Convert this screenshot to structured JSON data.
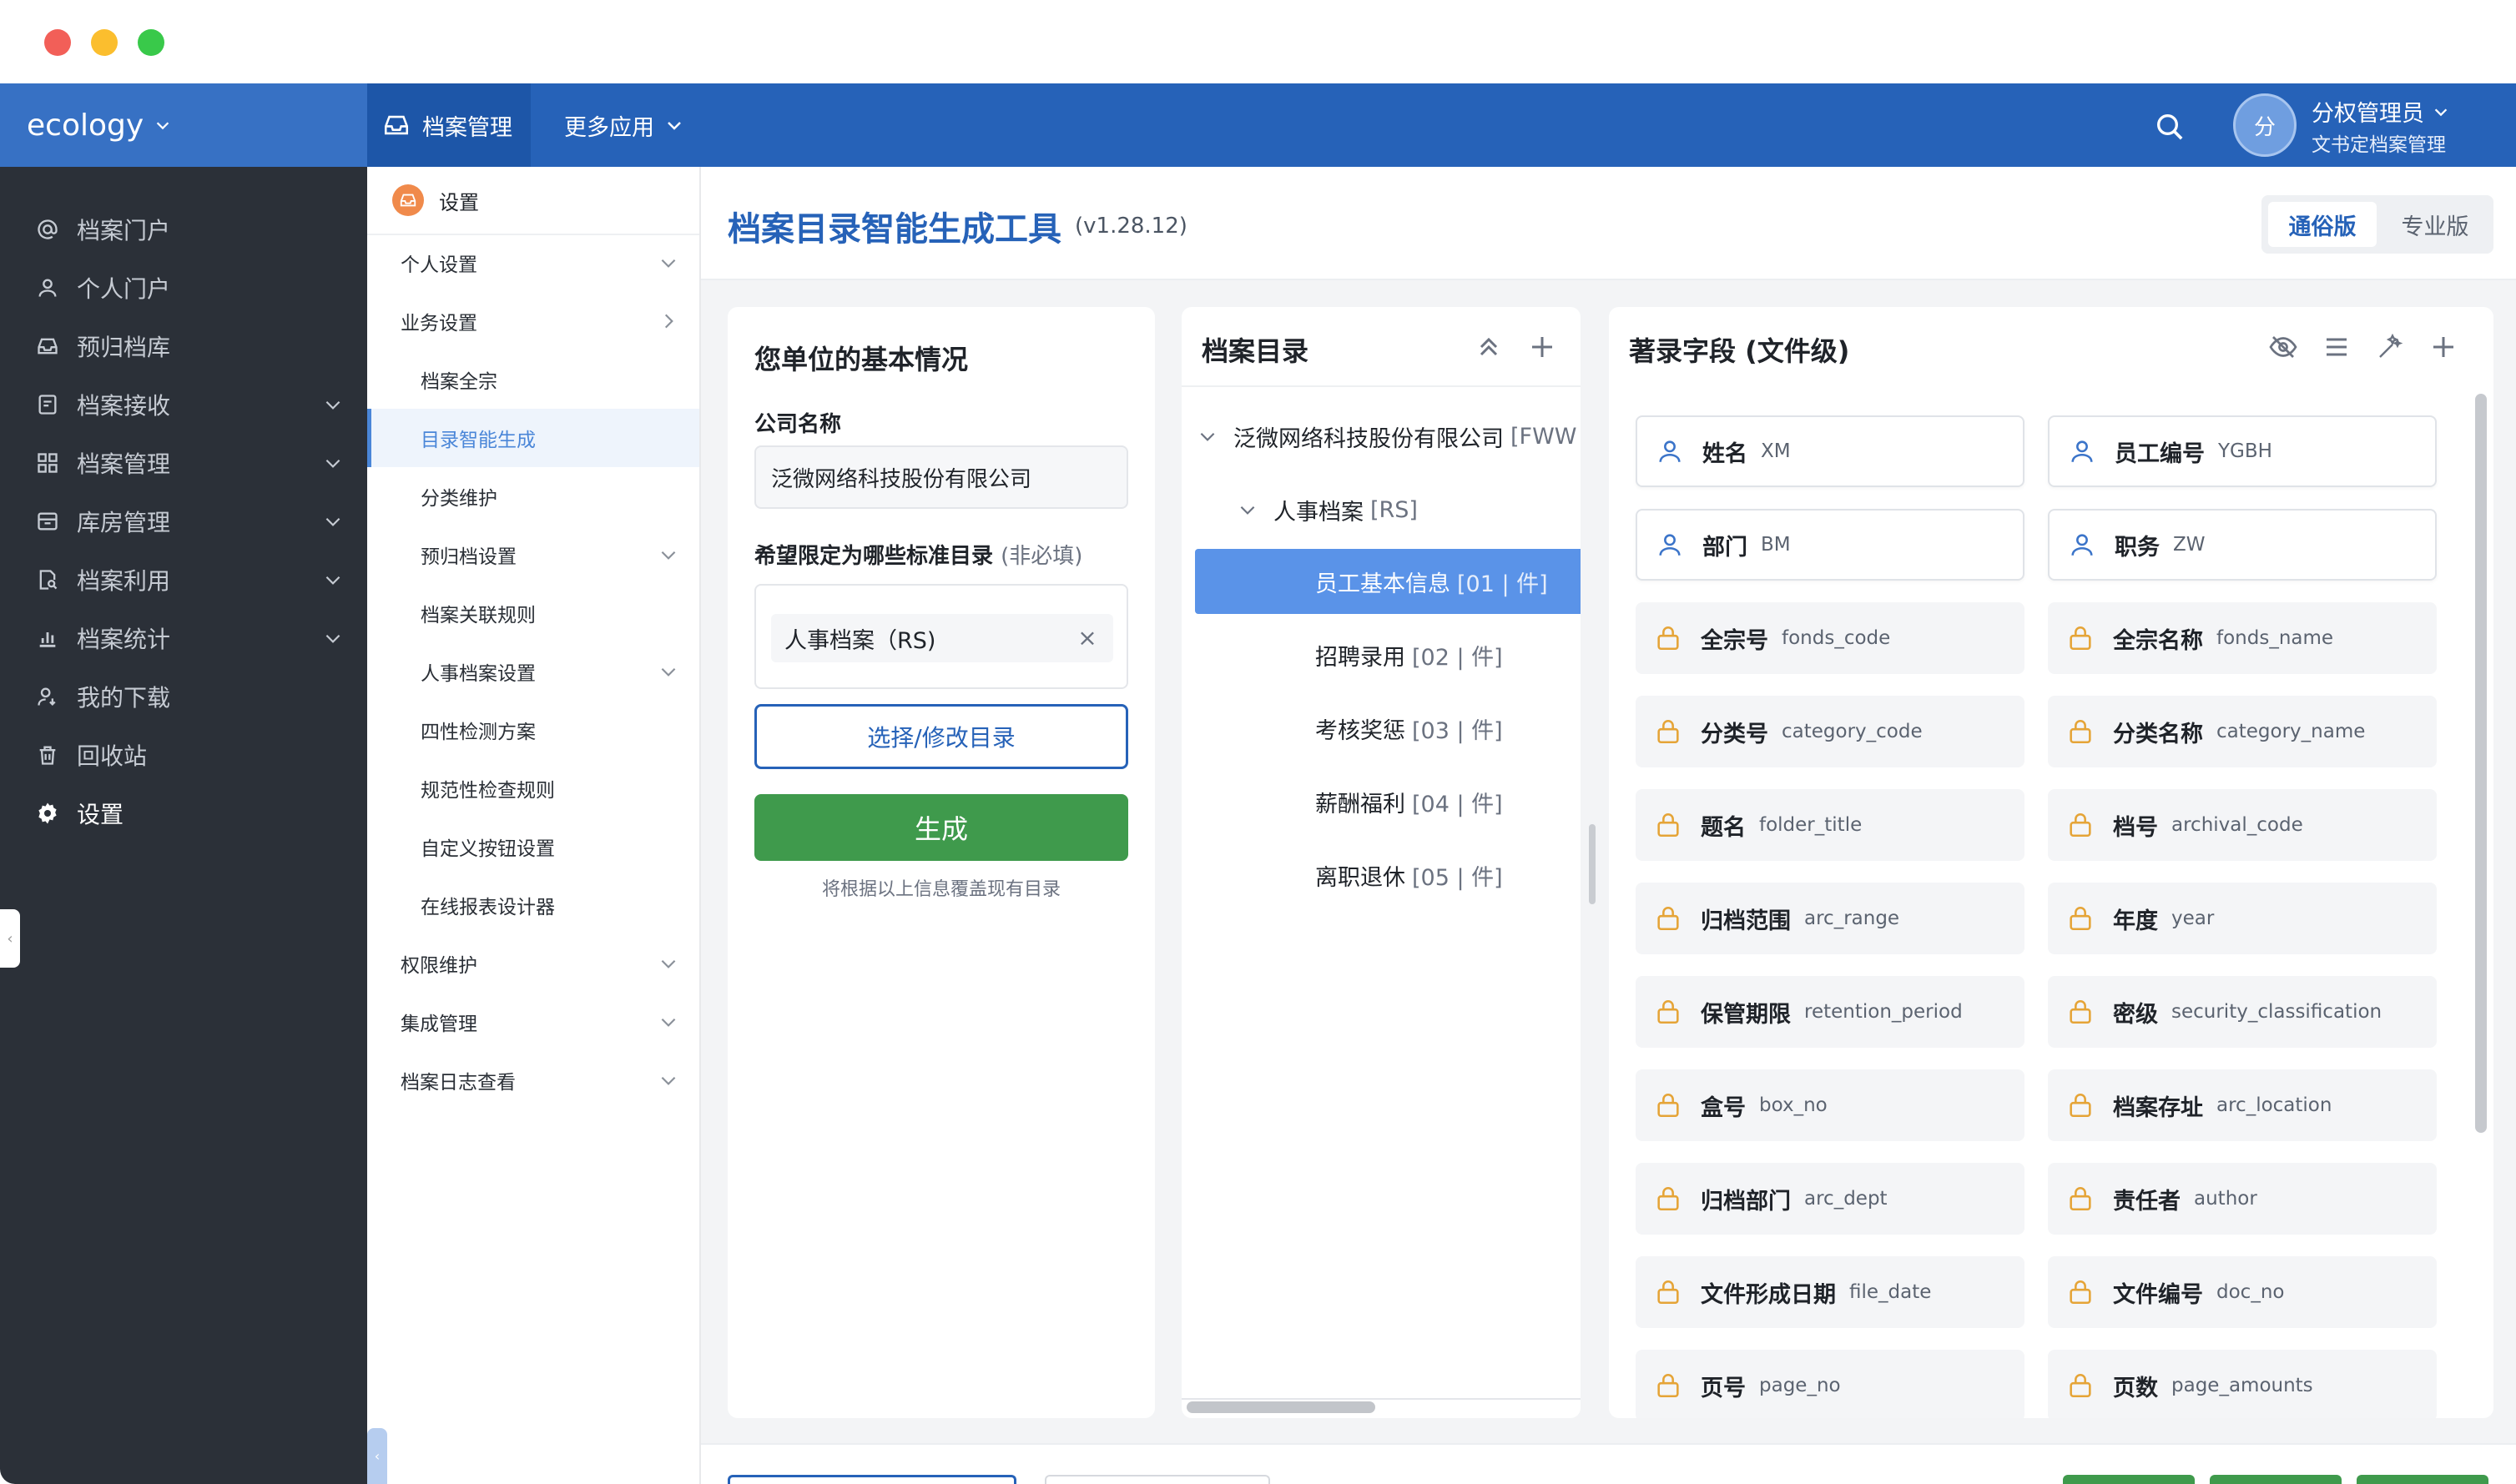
{
  "window": {
    "traffic_lights": [
      "#f25f58",
      "#fbbe2e",
      "#39c94a"
    ]
  },
  "topnav": {
    "brand": "ecology",
    "tabs": [
      {
        "label": "档案管理"
      },
      {
        "label": "更多应用"
      }
    ],
    "user": {
      "avatar_text": "分",
      "name": "分权管理员",
      "role": "文书定档案管理"
    },
    "colors": {
      "bar": "#2662b8",
      "brand": "#3771c4"
    }
  },
  "sidebar": {
    "items": [
      {
        "label": "档案门户",
        "icon": "at-icon"
      },
      {
        "label": "个人门户",
        "icon": "person-icon"
      },
      {
        "label": "预归档库",
        "icon": "inbox-icon"
      },
      {
        "label": "档案接收",
        "icon": "receive-icon",
        "expandable": true
      },
      {
        "label": "档案管理",
        "icon": "grid-icon",
        "expandable": true
      },
      {
        "label": "库房管理",
        "icon": "warehouse-icon",
        "expandable": true
      },
      {
        "label": "档案利用",
        "icon": "document-search-icon",
        "expandable": true
      },
      {
        "label": "档案统计",
        "icon": "bar-chart-icon",
        "expandable": true
      },
      {
        "label": "我的下载",
        "icon": "user-download-icon"
      },
      {
        "label": "回收站",
        "icon": "trash-icon"
      },
      {
        "label": "设置",
        "icon": "gear-icon",
        "active": true
      }
    ]
  },
  "subnav": {
    "header": "设置",
    "items": [
      {
        "label": "个人设置",
        "level": 1,
        "arrow": "down"
      },
      {
        "label": "业务设置",
        "level": 1,
        "arrow": "right"
      },
      {
        "label": "档案全宗",
        "level": 2
      },
      {
        "label": "目录智能生成",
        "level": 2,
        "active": true
      },
      {
        "label": "分类维护",
        "level": 2
      },
      {
        "label": "预归档设置",
        "level": 2,
        "arrow": "down"
      },
      {
        "label": "档案关联规则",
        "level": 2
      },
      {
        "label": "人事档案设置",
        "level": 2,
        "arrow": "down"
      },
      {
        "label": "四性检测方案",
        "level": 2
      },
      {
        "label": "规范性检查规则",
        "level": 2
      },
      {
        "label": "自定义按钮设置",
        "level": 2
      },
      {
        "label": "在线报表设计器",
        "level": 2
      },
      {
        "label": "权限维护",
        "level": 1,
        "arrow": "down"
      },
      {
        "label": "集成管理",
        "level": 1,
        "arrow": "down"
      },
      {
        "label": "档案日志查看",
        "level": 1,
        "arrow": "down"
      }
    ]
  },
  "main": {
    "title": "档案目录智能生成工具",
    "version": "(v1.28.12)",
    "editions": {
      "common": "通俗版",
      "pro": "专业版",
      "selected": "通俗版"
    }
  },
  "basic_info": {
    "title": "您单位的基本情况",
    "company_label": "公司名称",
    "company_value": "泛微网络科技股份有限公司",
    "limit_label": "希望限定为哪些标准目录",
    "limit_optional": "(非必填)",
    "selected_tags": [
      "人事档案（RS)"
    ],
    "select_button": "选择/修改目录",
    "generate_button": "生成",
    "hint": "将根据以上信息覆盖现有目录"
  },
  "catalog": {
    "title": "档案目录",
    "root": {
      "label": "泛微网络科技股份有限公司",
      "code": "[FWW"
    },
    "group": {
      "label": "人事档案",
      "code": "[RS]"
    },
    "children": [
      {
        "label": "员工基本信息",
        "code": "[01 | 件]",
        "selected": true
      },
      {
        "label": "招聘录用",
        "code": "[02 | 件]"
      },
      {
        "label": "考核奖惩",
        "code": "[03 | 件]"
      },
      {
        "label": "薪酬福利",
        "code": "[04 | 件]"
      },
      {
        "label": "离职退休",
        "code": "[05 | 件]"
      }
    ]
  },
  "fields": {
    "title": "著录字段 (文件级)",
    "items": [
      {
        "name": "姓名",
        "code": "XM",
        "type": "user"
      },
      {
        "name": "员工编号",
        "code": "YGBH",
        "type": "user"
      },
      {
        "name": "部门",
        "code": "BM",
        "type": "user"
      },
      {
        "name": "职务",
        "code": "ZW",
        "type": "user"
      },
      {
        "name": "全宗号",
        "code": "fonds_code",
        "type": "lock"
      },
      {
        "name": "全宗名称",
        "code": "fonds_name",
        "type": "lock"
      },
      {
        "name": "分类号",
        "code": "category_code",
        "type": "lock"
      },
      {
        "name": "分类名称",
        "code": "category_name",
        "type": "lock"
      },
      {
        "name": "题名",
        "code": "folder_title",
        "type": "lock"
      },
      {
        "name": "档号",
        "code": "archival_code",
        "type": "lock"
      },
      {
        "name": "归档范围",
        "code": "arc_range",
        "type": "lock"
      },
      {
        "name": "年度",
        "code": "year",
        "type": "lock"
      },
      {
        "name": "保管期限",
        "code": "retention_period",
        "type": "lock"
      },
      {
        "name": "密级",
        "code": "security_classification",
        "type": "lock"
      },
      {
        "name": "盒号",
        "code": "box_no",
        "type": "lock"
      },
      {
        "name": "档案存址",
        "code": "arc_location",
        "type": "lock"
      },
      {
        "name": "归档部门",
        "code": "arc_dept",
        "type": "lock"
      },
      {
        "name": "责任者",
        "code": "author",
        "type": "lock"
      },
      {
        "name": "文件形成日期",
        "code": "file_date",
        "type": "lock"
      },
      {
        "name": "文件编号",
        "code": "doc_no",
        "type": "lock"
      },
      {
        "name": "页号",
        "code": "page_no",
        "type": "lock"
      },
      {
        "name": "页数",
        "code": "page_amounts",
        "type": "lock"
      }
    ]
  },
  "colors": {
    "primary": "#2662b8",
    "success": "#3f9a4c",
    "selected_row": "#5a93e8",
    "lock": "#e5a437",
    "user_icon": "#3b74c9"
  }
}
